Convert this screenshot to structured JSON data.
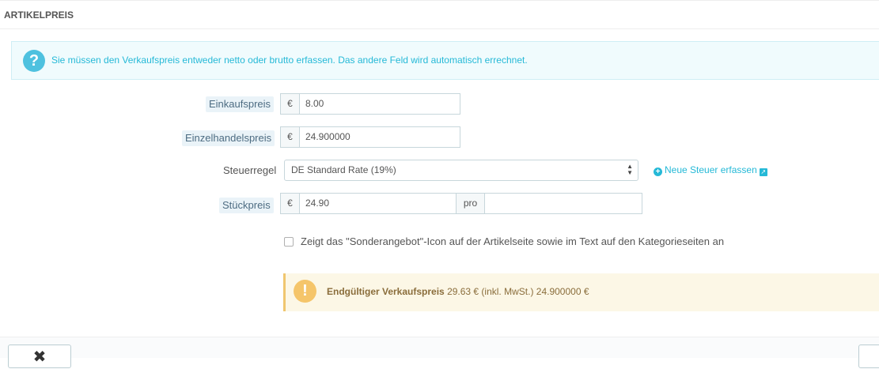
{
  "panel": {
    "title": "ARTIKELPREIS"
  },
  "info": {
    "icon": "question-circle-icon",
    "text": "Sie müssen den Verkaufspreis entweder netto oder brutto erfassen. Das andere Feld wird automatisch errechnet."
  },
  "form": {
    "purchase_price": {
      "label": "Einkaufspreis",
      "currency": "€",
      "value": "8.00"
    },
    "retail_price": {
      "label": "Einzelhandelspreis",
      "currency": "€",
      "value": "24.900000"
    },
    "tax_rule": {
      "label": "Steuerregel",
      "selected": "DE Standard Rate (19%)"
    },
    "new_tax_link": {
      "label": "Neue Steuer erfassen",
      "icon": "plus-circle-icon",
      "ext_icon": "external-link-icon"
    },
    "unit_price": {
      "label": "Stückpreis",
      "currency": "€",
      "value": "24.90",
      "per_label": "pro",
      "unit_value": ""
    },
    "special_offer": {
      "checked": false,
      "label": "Zeigt das \"Sonderangebot\"-Icon auf der Artikelseite sowie im Text auf den Kategorieseiten an"
    }
  },
  "final_price": {
    "icon": "exclamation-circle-icon",
    "label": "Endgültiger Verkaufspreis",
    "details": "29.63 € (inkl. MwSt.) 24.900000 €"
  },
  "footer": {
    "cancel_icon": "close-icon"
  }
}
